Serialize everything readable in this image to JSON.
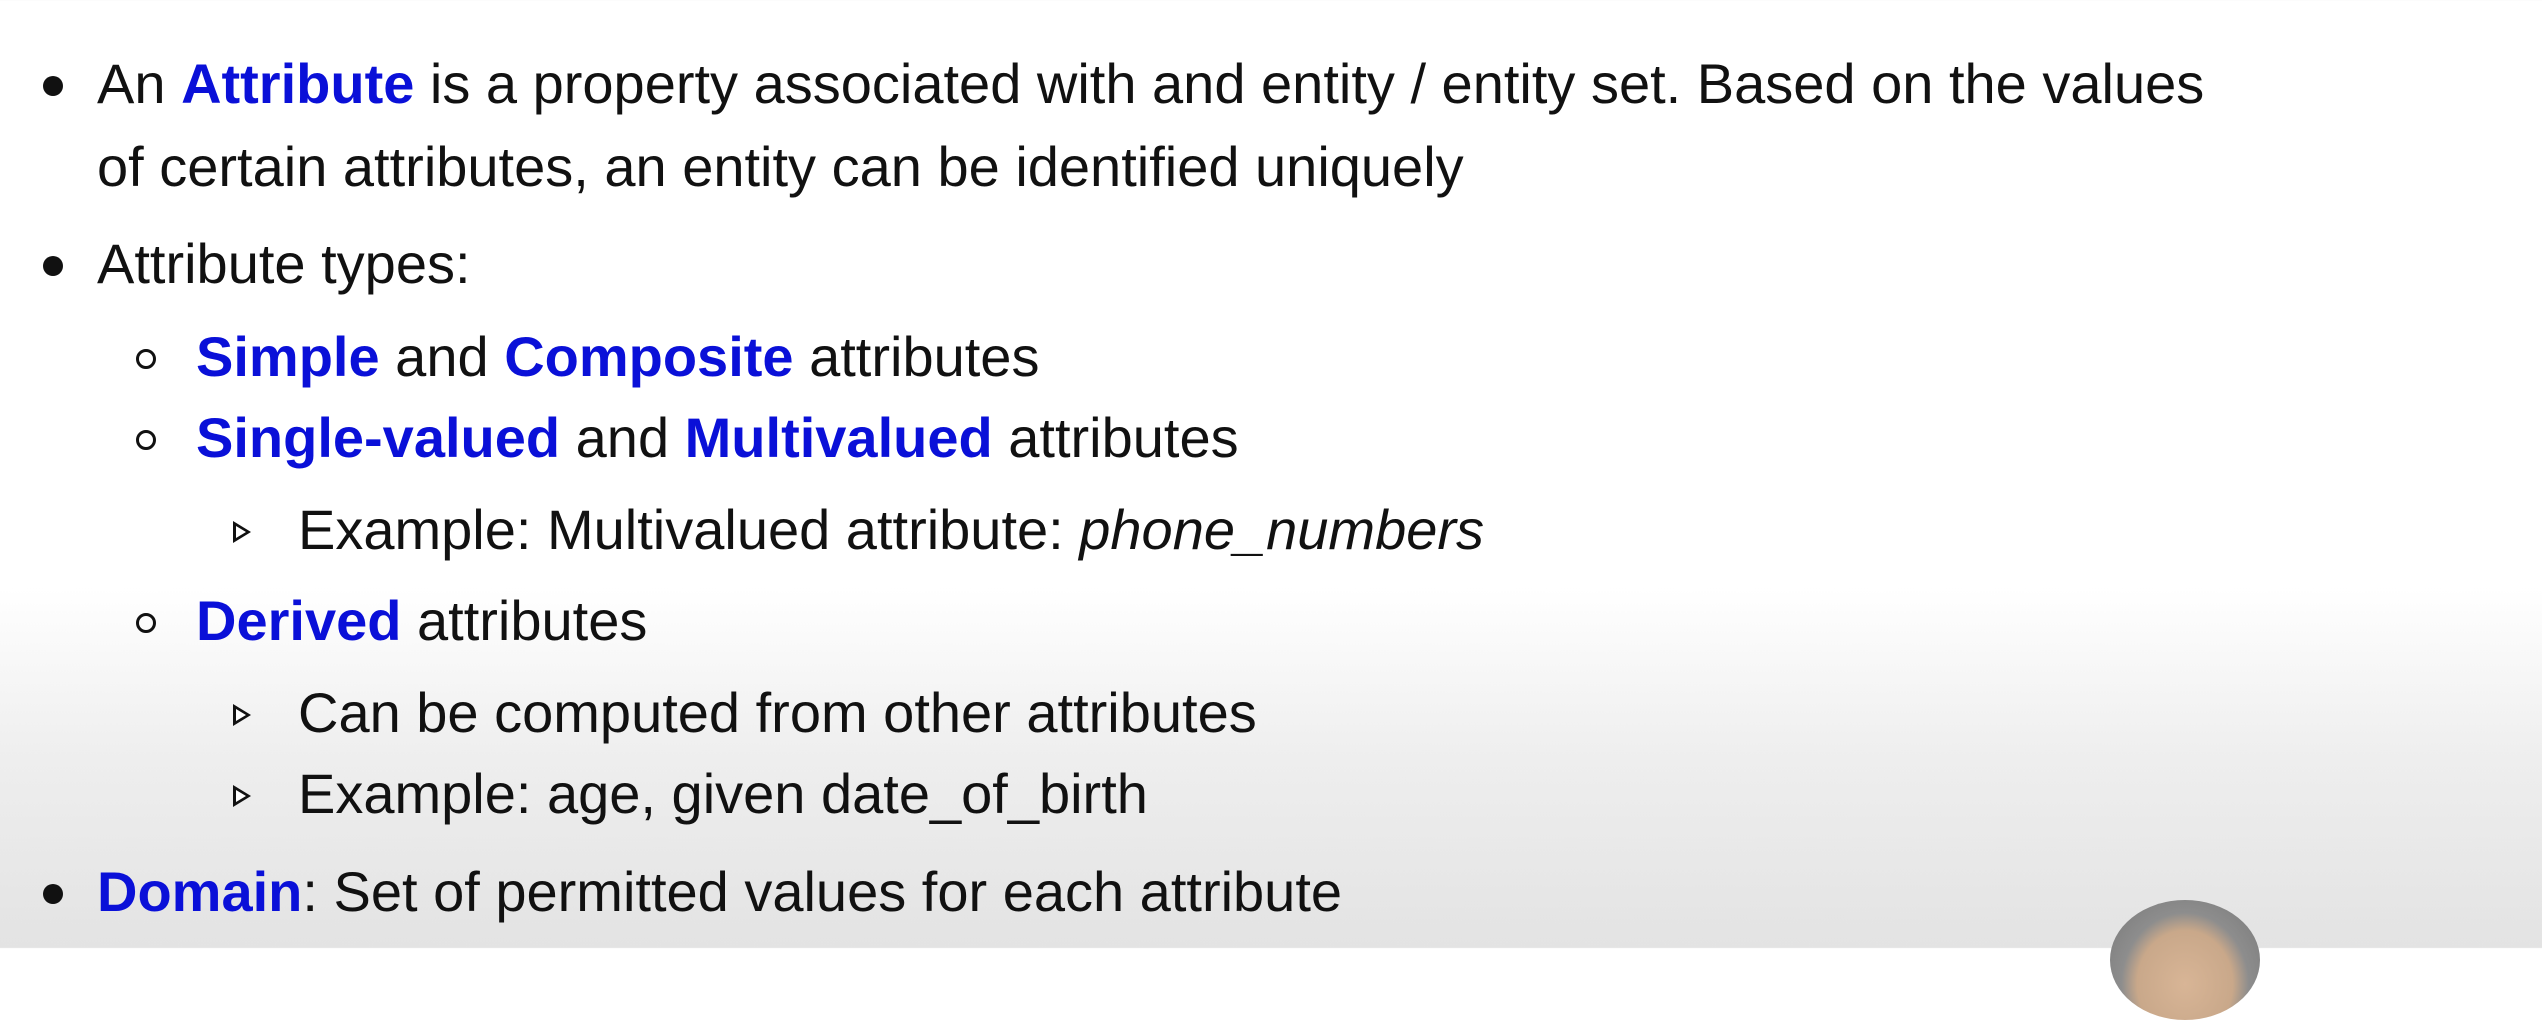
{
  "items": [
    {
      "parts": [
        "An ",
        "Attribute",
        " is a property associated with and entity / entity set. Based on the values"
      ],
      "cont": "of certain attributes, an entity can be identified uniquely"
    },
    {
      "text": "Attribute types:"
    },
    {
      "parts": [
        "Simple",
        " and ",
        "Composite",
        " attributes"
      ]
    },
    {
      "parts": [
        "Single-valued",
        " and ",
        "Multivalued",
        " attributes"
      ]
    },
    {
      "parts": [
        "Example: Multivalued attribute: ",
        "phone_numbers"
      ]
    },
    {
      "parts": [
        "Derived",
        " attributes"
      ]
    },
    {
      "text": "Can be computed from other attributes"
    },
    {
      "text": "Example: age, given date_of_birth"
    },
    {
      "parts": [
        "Domain",
        ": Set of permitted values for each attribute"
      ]
    }
  ],
  "colors": {
    "highlight": "#0a10d8",
    "text": "#111111"
  }
}
